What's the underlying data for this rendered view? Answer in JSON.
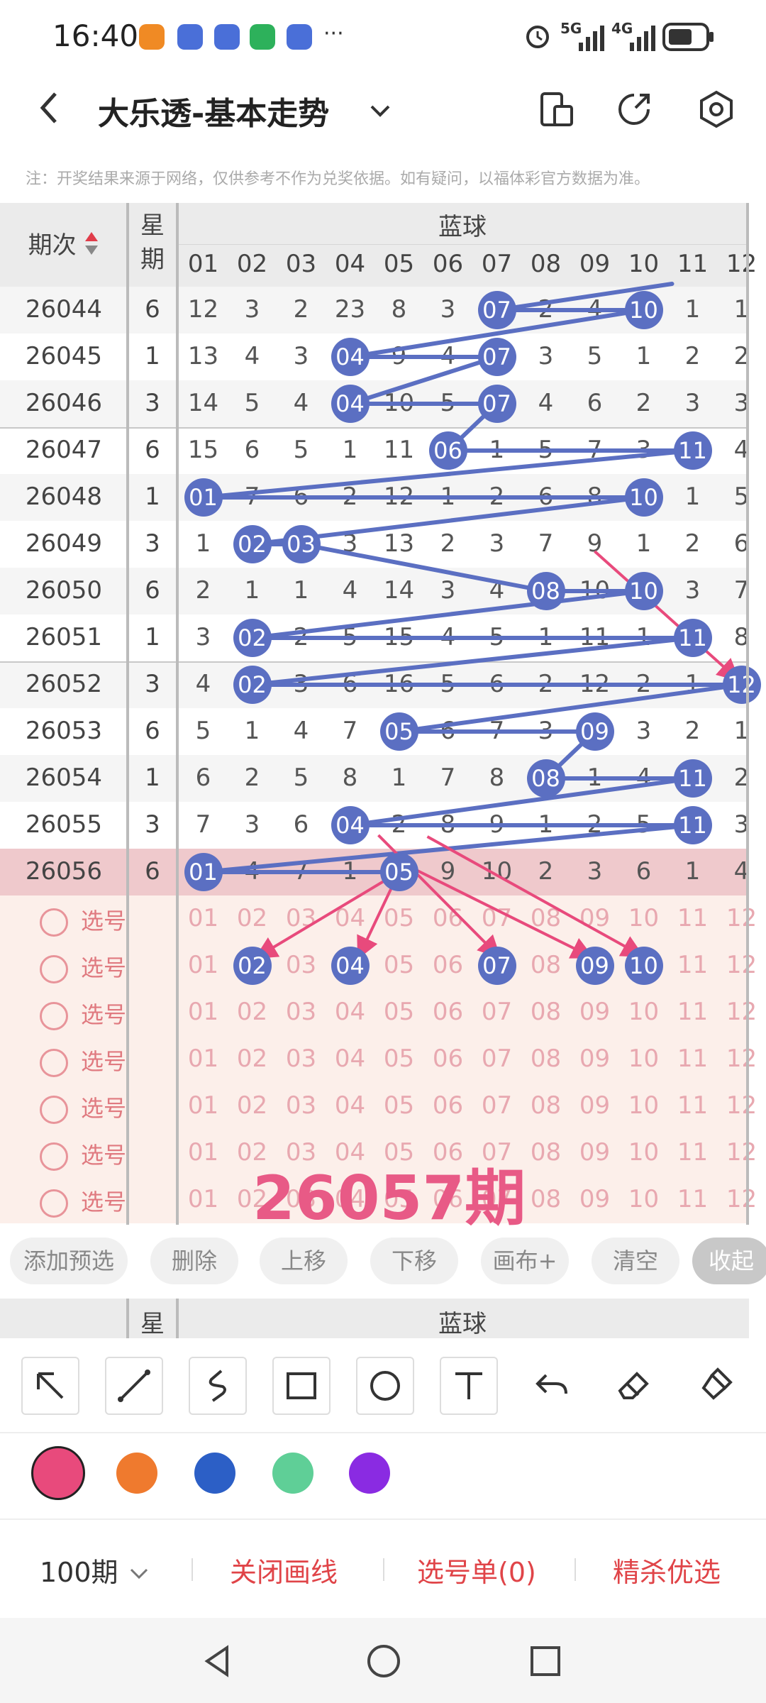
{
  "status_bar": {
    "time": "16:40",
    "more": "···",
    "signal_5g": "5G",
    "signal_4g": "4G"
  },
  "header": {
    "title": "大乐透-基本走势"
  },
  "notice": "注：开奖结果来源于网络，仅供参考不作为兑奖依据。如有疑问，以福体彩官方数据为准。",
  "table": {
    "period_header": "期次",
    "week_header": "星期",
    "week_header_line1": "星",
    "week_header_line2": "期",
    "blue_header": "蓝球",
    "columns": [
      "01",
      "02",
      "03",
      "04",
      "05",
      "06",
      "07",
      "08",
      "09",
      "10",
      "11",
      "12"
    ],
    "rows": [
      {
        "period": "26044",
        "week": "6",
        "cells": [
          "12",
          "3",
          "2",
          "23",
          "8",
          "3",
          "07",
          "2",
          "4",
          "10",
          "1",
          "1"
        ]
      },
      {
        "period": "26045",
        "week": "1",
        "cells": [
          "13",
          "4",
          "3",
          "04",
          "9",
          "4",
          "07",
          "3",
          "5",
          "1",
          "2",
          "2"
        ]
      },
      {
        "period": "26046",
        "week": "3",
        "cells": [
          "14",
          "5",
          "4",
          "04",
          "10",
          "5",
          "07",
          "4",
          "6",
          "2",
          "3",
          "3"
        ]
      },
      {
        "period": "26047",
        "week": "6",
        "cells": [
          "15",
          "6",
          "5",
          "1",
          "11",
          "06",
          "1",
          "5",
          "7",
          "3",
          "11",
          "4"
        ]
      },
      {
        "period": "26048",
        "week": "1",
        "cells": [
          "01",
          "7",
          "6",
          "2",
          "12",
          "1",
          "2",
          "6",
          "8",
          "10",
          "1",
          "5"
        ]
      },
      {
        "period": "26049",
        "week": "3",
        "cells": [
          "1",
          "02",
          "03",
          "3",
          "13",
          "2",
          "3",
          "7",
          "9",
          "1",
          "2",
          "6"
        ]
      },
      {
        "period": "26050",
        "week": "6",
        "cells": [
          "2",
          "1",
          "1",
          "4",
          "14",
          "3",
          "4",
          "08",
          "10",
          "10",
          "3",
          "7"
        ]
      },
      {
        "period": "26051",
        "week": "1",
        "cells": [
          "3",
          "02",
          "2",
          "5",
          "15",
          "4",
          "5",
          "1",
          "11",
          "1",
          "11",
          "8"
        ]
      },
      {
        "period": "26052",
        "week": "3",
        "cells": [
          "4",
          "02",
          "3",
          "6",
          "16",
          "5",
          "6",
          "2",
          "12",
          "2",
          "1",
          "12"
        ]
      },
      {
        "period": "26053",
        "week": "6",
        "cells": [
          "5",
          "1",
          "4",
          "7",
          "05",
          "6",
          "7",
          "3",
          "09",
          "3",
          "2",
          "1"
        ]
      },
      {
        "period": "26054",
        "week": "1",
        "cells": [
          "6",
          "2",
          "5",
          "8",
          "1",
          "7",
          "8",
          "08",
          "1",
          "4",
          "11",
          "2"
        ]
      },
      {
        "period": "26055",
        "week": "3",
        "cells": [
          "7",
          "3",
          "6",
          "04",
          "2",
          "8",
          "9",
          "1",
          "2",
          "5",
          "11",
          "3"
        ]
      },
      {
        "period": "26056",
        "week": "6",
        "cells": [
          "01",
          "4",
          "7",
          "1",
          "05",
          "9",
          "10",
          "2",
          "3",
          "6",
          "1",
          "4"
        ]
      }
    ],
    "pick_label": "选号",
    "pick_rows": 7,
    "picked_balls": [
      "02",
      "04",
      "07",
      "09",
      "10"
    ],
    "watermark": "26057期"
  },
  "actions": [
    "添加预选",
    "删除",
    "上移",
    "下移",
    "画布+",
    "清空",
    "收起"
  ],
  "footer_header": {
    "week_header": "星",
    "blue_header": "蓝球"
  },
  "tools": [
    "arrow-tool",
    "line-tool",
    "curve-tool",
    "rectangle-tool",
    "circle-tool",
    "text-tool",
    "undo-tool",
    "eraser-tool",
    "clear-tool"
  ],
  "colors": [
    "#e84a7c",
    "#ef7a2e",
    "#2c5fc6",
    "#5fcf97",
    "#8a2be2"
  ],
  "bottom_bar": {
    "period_select": "100期",
    "close_lines": "关闭画线",
    "pick_list": "选号单(0)",
    "premium": "精杀优选"
  }
}
